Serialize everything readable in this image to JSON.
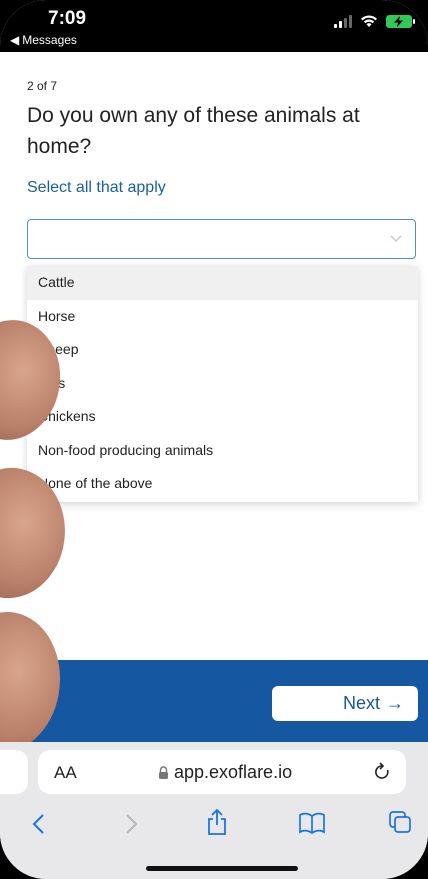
{
  "status_bar": {
    "time": "7:09",
    "back_app": "Messages"
  },
  "form": {
    "progress": "2 of 7",
    "question": "Do you own any of these animals at home?",
    "subtitle": "Select all that apply",
    "select_value": ""
  },
  "dropdown": {
    "options": [
      {
        "label": "Cattle",
        "highlighted": true
      },
      {
        "label": "Horse"
      },
      {
        "label": "Sheep"
      },
      {
        "label": "Pigs"
      },
      {
        "label": "Chickens"
      },
      {
        "label": "Non-food producing animals"
      },
      {
        "label": "None of the above"
      }
    ]
  },
  "footer": {
    "next_label": "Next",
    "next_arrow": "→"
  },
  "safari": {
    "text_size_label": "AA",
    "url": "app.exoflare.io",
    "icons": [
      "lock-icon",
      "reload-icon",
      "back-icon",
      "forward-icon",
      "share-icon",
      "bookmarks-icon",
      "tabs-icon"
    ]
  },
  "colors": {
    "brand_blue": "#1557a0",
    "link_blue": "#1a5f9e",
    "battery_green": "#34c759"
  }
}
